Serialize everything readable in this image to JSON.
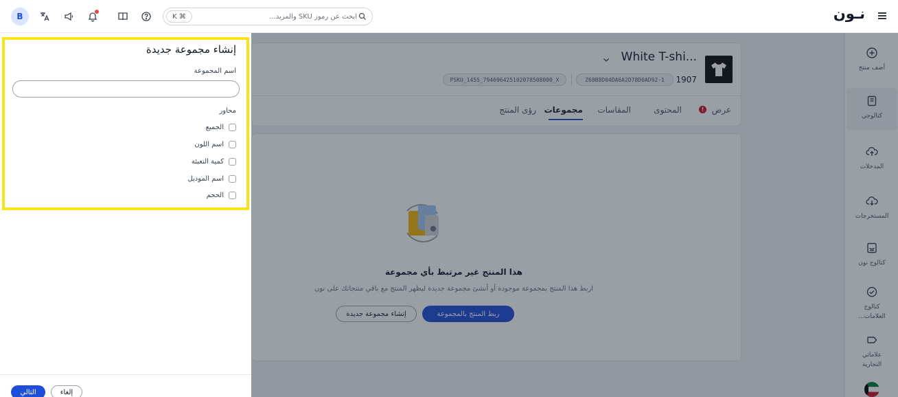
{
  "topbar": {
    "avatar_initial": "B",
    "search_shortcut": "K ⌘",
    "search_placeholder": "ابحث عن رموز SKU والمزيد...",
    "logo_text": "نـون",
    "icons": [
      "translate-icon",
      "megaphone-icon",
      "bell-icon",
      "book-icon",
      "help-icon",
      "search-icon",
      "menu-icon"
    ]
  },
  "rail": {
    "items": [
      {
        "label": "أضف منتج",
        "icon": "plus-circle-icon"
      },
      {
        "label": "كتالوجي",
        "icon": "catalog-icon"
      },
      {
        "label": "المدخلات",
        "icon": "cloud-upload-icon"
      },
      {
        "label": "المستخرجات",
        "icon": "cloud-download-icon"
      },
      {
        "label": "كتالوج نون",
        "icon": "noon-catalog-icon"
      },
      {
        "label": "كتالوج العلامات...",
        "icon": "check-circle-icon"
      },
      {
        "label": "علاماتي التجارية",
        "icon": "tag-icon"
      }
    ],
    "region_flag": "kuwait-flag-icon"
  },
  "product": {
    "title": "White T-shi...",
    "number": "1907",
    "sku_chip": "Z68B8D04DA6A2D78D0AD92-1",
    "psku_chip": "PSKU_1455_794696425102078508000_X",
    "tabs": {
      "view": "عرض",
      "content": "المحتوى",
      "sizes": "المقاسات",
      "groups": "مجموعات",
      "insights": "رؤى المنتج"
    },
    "active_tab": "مجموعات"
  },
  "empty_state": {
    "title": "هذا المنتج غير مرتبط بأي مجموعة",
    "subtitle": "اربط هذا المنتج بمجموعة موجودة أو أنشئ مجموعة جديدة ليظهر المنتج مع باقي منتجاتك على نون",
    "link_button": "ربط المنتج بالمجموعة",
    "create_button": "إنشاء مجموعة جديدة"
  },
  "drawer": {
    "title": "إنشاء مجموعة جديدة",
    "name_label": "اسم المجموعة",
    "name_value": "",
    "axes_label": "محاور",
    "axes": [
      "الجميع",
      "اسم اللون",
      "كمية التعبئة",
      "اسم الموديل",
      "الحجم"
    ],
    "next_button": "التالي",
    "cancel_button": "إلغاء"
  },
  "colors": {
    "accent": "#1d4ed8",
    "highlight": "#f9e21a",
    "warning": "#c8102e"
  }
}
